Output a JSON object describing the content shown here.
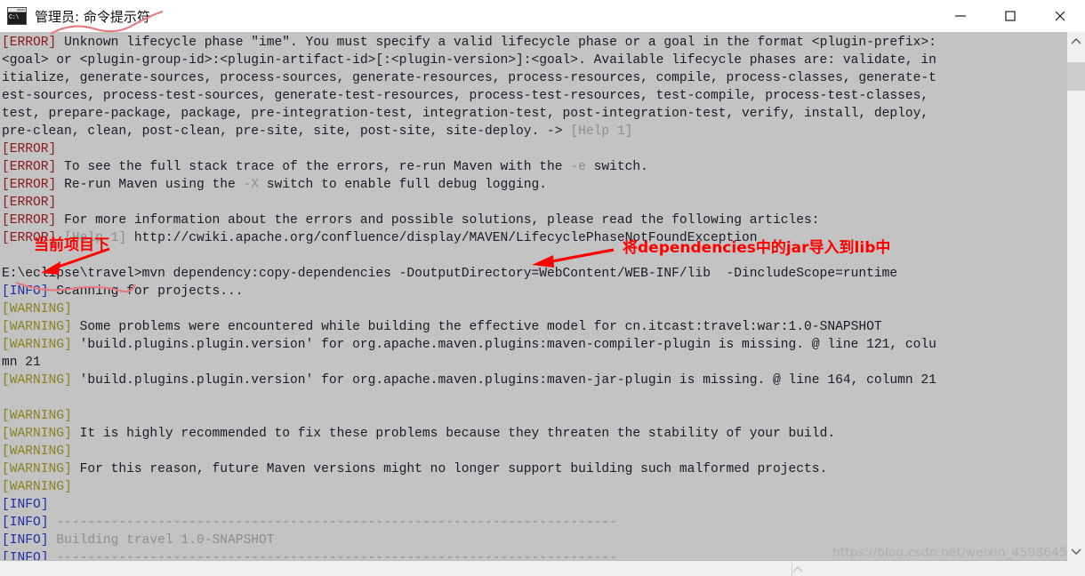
{
  "window": {
    "title": "管理员: 命令提示符",
    "icon": "cmd-icon",
    "icon_text": "C:\\",
    "controls": {
      "minimize": "minimize-icon",
      "maximize": "maximize-icon",
      "close": "close-icon"
    }
  },
  "colors": {
    "console_bg": "#c3c3c3",
    "error": "#8b1a1a",
    "warning": "#8a8320",
    "info": "#1e2ea8",
    "dim": "#8e8e8e",
    "text": "#1a1a28",
    "annotation": "#ff0000",
    "titlebar_bg": "#ffffff"
  },
  "console": {
    "lines": [
      [
        {
          "t": "[ERROR]",
          "c": "err"
        },
        {
          "t": " Unknown lifecycle phase \"ime\". You must specify a valid lifecycle phase or a goal in the format <plugin-prefix>:",
          "c": "norm"
        }
      ],
      [
        {
          "t": "<goal> or <plugin-group-id>:<plugin-artifact-id>[:<plugin-version>]:<goal>. Available lifecycle phases are: validate, in",
          "c": "norm"
        }
      ],
      [
        {
          "t": "itialize, generate-sources, process-sources, generate-resources, process-resources, compile, process-classes, generate-t",
          "c": "norm"
        }
      ],
      [
        {
          "t": "est-sources, process-test-sources, generate-test-resources, process-test-resources, test-compile, process-test-classes,",
          "c": "norm"
        }
      ],
      [
        {
          "t": "test, prepare-package, package, pre-integration-test, integration-test, post-integration-test, verify, install, deploy,",
          "c": "norm"
        }
      ],
      [
        {
          "t": "pre-clean, clean, post-clean, pre-site, site, post-site, site-deploy. -> ",
          "c": "norm"
        },
        {
          "t": "[Help 1]",
          "c": "dim"
        }
      ],
      [
        {
          "t": "[ERROR]",
          "c": "err"
        }
      ],
      [
        {
          "t": "[ERROR]",
          "c": "err"
        },
        {
          "t": " To see the full stack trace of the errors, re-run Maven with the ",
          "c": "norm"
        },
        {
          "t": "-e",
          "c": "dim"
        },
        {
          "t": " switch.",
          "c": "norm"
        }
      ],
      [
        {
          "t": "[ERROR]",
          "c": "err"
        },
        {
          "t": " Re-run Maven using the ",
          "c": "norm"
        },
        {
          "t": "-X",
          "c": "dim"
        },
        {
          "t": " switch to enable full debug logging.",
          "c": "norm"
        }
      ],
      [
        {
          "t": "[ERROR]",
          "c": "err"
        }
      ],
      [
        {
          "t": "[ERROR]",
          "c": "err"
        },
        {
          "t": " For more information about the errors and possible solutions, please read the following articles:",
          "c": "norm"
        }
      ],
      [
        {
          "t": "[ERROR]",
          "c": "err"
        },
        {
          "t": " ",
          "c": "norm"
        },
        {
          "t": "[Help 1]",
          "c": "dim"
        },
        {
          "t": " http://cwiki.apache.org/confluence/display/MAVEN/LifecyclePhaseNotFoundException",
          "c": "norm"
        }
      ],
      [
        {
          "t": "",
          "c": "norm"
        }
      ],
      [
        {
          "t": "E:\\eclipse\\travel>mvn dependency:copy-dependencies -DoutputDirectory=WebContent/WEB-INF/lib  -DincludeScope=runtime",
          "c": "norm"
        }
      ],
      [
        {
          "t": "[INFO]",
          "c": "info"
        },
        {
          "t": " Scanning for projects...",
          "c": "norm"
        }
      ],
      [
        {
          "t": "[WARNING]",
          "c": "warn"
        }
      ],
      [
        {
          "t": "[WARNING]",
          "c": "warn"
        },
        {
          "t": " Some problems were encountered while building the effective model for cn.itcast:travel:war:1.0-SNAPSHOT",
          "c": "norm"
        }
      ],
      [
        {
          "t": "[WARNING]",
          "c": "warn"
        },
        {
          "t": " 'build.plugins.plugin.version' for org.apache.maven.plugins:maven-compiler-plugin is missing. @ line 121, colu",
          "c": "norm"
        }
      ],
      [
        {
          "t": "mn 21",
          "c": "norm"
        }
      ],
      [
        {
          "t": "[WARNING]",
          "c": "warn"
        },
        {
          "t": " 'build.plugins.plugin.version' for org.apache.maven.plugins:maven-jar-plugin is missing. @ line 164, column 21",
          "c": "norm"
        }
      ],
      [
        {
          "t": "",
          "c": "norm"
        }
      ],
      [
        {
          "t": "[WARNING]",
          "c": "warn"
        }
      ],
      [
        {
          "t": "[WARNING]",
          "c": "warn"
        },
        {
          "t": " It is highly recommended to fix these problems because they threaten the stability of your build.",
          "c": "norm"
        }
      ],
      [
        {
          "t": "[WARNING]",
          "c": "warn"
        }
      ],
      [
        {
          "t": "[WARNING]",
          "c": "warn"
        },
        {
          "t": " For this reason, future Maven versions might no longer support building such malformed projects.",
          "c": "norm"
        }
      ],
      [
        {
          "t": "[WARNING]",
          "c": "warn"
        }
      ],
      [
        {
          "t": "[INFO]",
          "c": "info"
        }
      ],
      [
        {
          "t": "[INFO]",
          "c": "info"
        },
        {
          "t": " ------------------------------------------------------------------------",
          "c": "dim"
        }
      ],
      [
        {
          "t": "[INFO]",
          "c": "info"
        },
        {
          "t": " Building travel 1.0-SNAPSHOT",
          "c": "dim"
        }
      ],
      [
        {
          "t": "[INFO]",
          "c": "info"
        },
        {
          "t": " ------------------------------------------------------------------------",
          "c": "dim"
        }
      ]
    ]
  },
  "annotations": {
    "left_note": "当前项目下",
    "right_note": "将dependencies中的jar导入到lib中"
  },
  "watermark": {
    "text": "https://blog.csdn.net/weixin_4598645"
  },
  "scrollbars": {
    "vertical_up": "chevron-up-icon",
    "vertical_down": "chevron-down-icon",
    "horizontal_right": "chevron-up-icon"
  }
}
